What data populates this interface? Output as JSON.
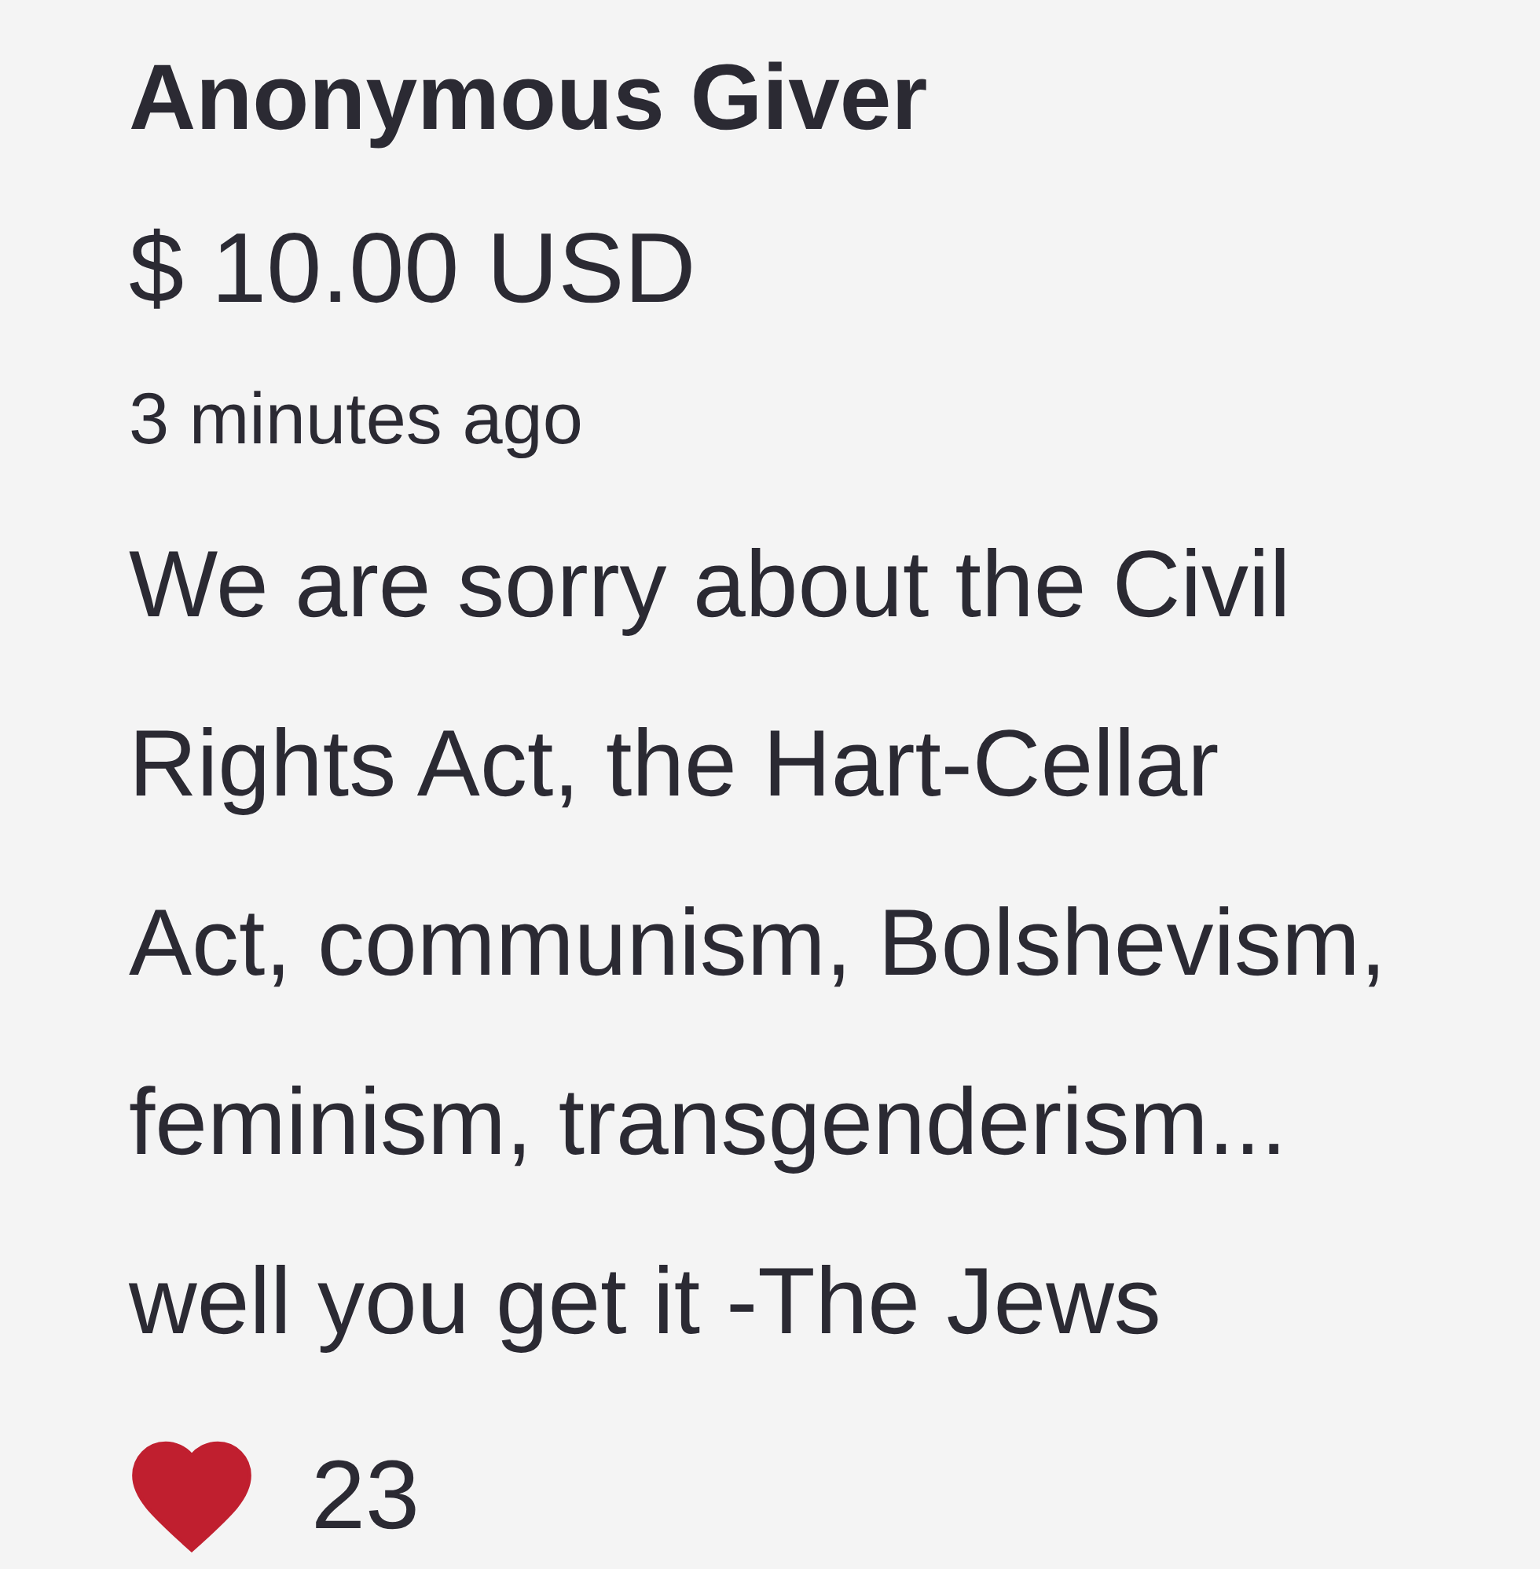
{
  "donation": {
    "donor_name": "Anonymous Giver",
    "amount": "$ 10.00 USD",
    "time": "3 minutes ago",
    "message": "We are sorry about the Civil Rights Act, the Hart-Cellar Act, communism, Bolshevism, feminism, transgenderism... well you get it -The Jews",
    "likes": {
      "liked": true,
      "count": "23"
    }
  }
}
